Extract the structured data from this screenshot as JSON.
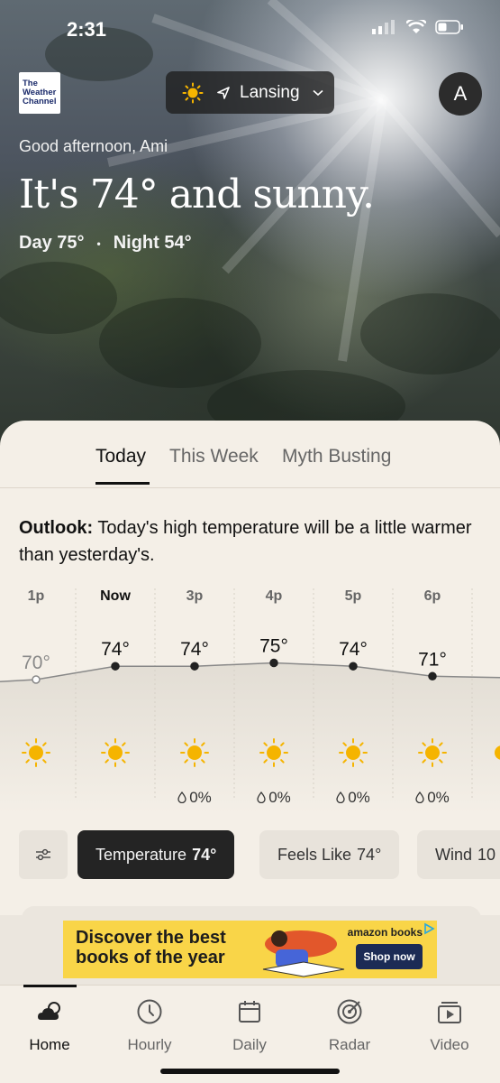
{
  "status_bar": {
    "time": "2:31"
  },
  "brand": {
    "logo_text": [
      "The",
      "Weather",
      "Channel"
    ]
  },
  "location": {
    "name": "Lansing"
  },
  "profile": {
    "initial": "A"
  },
  "greeting": "Good afternoon, Ami",
  "headline": "It's 74° and sunny.",
  "day_night": {
    "day": "Day 75°",
    "separator": "•",
    "night": "Night 54°"
  },
  "tabs": [
    {
      "label": "Today",
      "active": true
    },
    {
      "label": "This Week",
      "active": false
    },
    {
      "label": "Myth Busting",
      "active": false
    }
  ],
  "outlook": {
    "label": "Outlook:",
    "text": "Today's high temperature will be a little warmer than yesterday's."
  },
  "hourly": [
    {
      "time": "1p",
      "temp": "70°",
      "temp_value": 70,
      "past": true,
      "icon": "sun-icon",
      "precip": ""
    },
    {
      "time": "Now",
      "temp": "74°",
      "temp_value": 74,
      "past": false,
      "icon": "sun-icon",
      "precip": ""
    },
    {
      "time": "3p",
      "temp": "74°",
      "temp_value": 74,
      "past": false,
      "icon": "sun-icon",
      "precip": "0%"
    },
    {
      "time": "4p",
      "temp": "75°",
      "temp_value": 75,
      "past": false,
      "icon": "sun-icon",
      "precip": "0%"
    },
    {
      "time": "5p",
      "temp": "74°",
      "temp_value": 74,
      "past": false,
      "icon": "sun-icon",
      "precip": "0%"
    },
    {
      "time": "6p",
      "temp": "71°",
      "temp_value": 71,
      "past": false,
      "icon": "sun-icon",
      "precip": "0%"
    }
  ],
  "chips": {
    "temperature": {
      "label": "Temperature",
      "value": "74°"
    },
    "feels_like": {
      "label": "Feels Like",
      "value": "74°"
    },
    "wind": {
      "label": "Wind",
      "value": "10"
    }
  },
  "ad": {
    "headline_line1": "Discover the best",
    "headline_line2": "books of the year",
    "brand": "amazon books",
    "cta": "Shop now"
  },
  "nav": [
    {
      "label": "Home",
      "icon": "cloud-icon",
      "active": true
    },
    {
      "label": "Hourly",
      "icon": "clock-icon",
      "active": false
    },
    {
      "label": "Daily",
      "icon": "calendar-icon",
      "active": false
    },
    {
      "label": "Radar",
      "icon": "radar-icon",
      "active": false
    },
    {
      "label": "Video",
      "icon": "video-icon",
      "active": false
    }
  ],
  "colors": {
    "sun": "#f5b400",
    "accent_dark": "#242424",
    "sheet_bg": "#f4efe7"
  }
}
